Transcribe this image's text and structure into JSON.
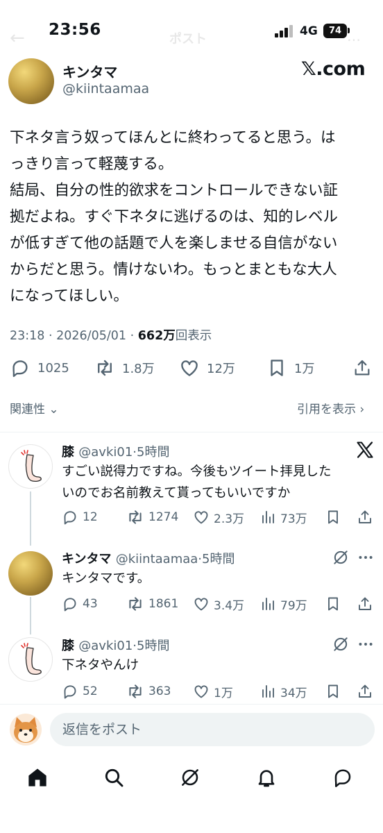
{
  "status": {
    "time": "23:56",
    "network": "4G",
    "battery": "74"
  },
  "header": {
    "back_ghost": "←",
    "title_ghost": "ポスト",
    "more_ghost": "…"
  },
  "post": {
    "name": "キンタマ",
    "handle": "@kiintaamaa",
    "watermark": "𝕏.com",
    "lines": [
      "下ネタ言う奴ってほんとに終わってると思う。は",
      "っきり言って軽蔑する。",
      "結局、自分の性的欲求をコントロールできない証",
      "拠だよね。すぐ下ネタに逃げるのは、知的レベル",
      "が低すぎて他の話題で人を楽しませる自信がない",
      "からだと思う。情けないわ。もっとまともな大人",
      "になってほしい。"
    ],
    "time": "23:18",
    "date": "2026/05/01",
    "views": "662万",
    "views_label": "回表示",
    "stats": {
      "replies": "1025",
      "reposts": "1.8万",
      "likes": "12万",
      "bookmarks": "1万"
    }
  },
  "sort": {
    "label": "関連性",
    "quotes_label": "引用を表示"
  },
  "replies": [
    {
      "name": "膝",
      "handle": "@avki01",
      "time": "5時間",
      "lines": [
        "すごい説得力ですね。今後もツイート拝見した",
        "いのでお名前教えて貰ってもいいですか"
      ],
      "stats": {
        "replies": "12",
        "reposts": "1274",
        "likes": "2.3万",
        "views": "73万"
      }
    },
    {
      "name": "キンタマ",
      "handle": "@kiintaamaa",
      "time": "5時間",
      "lines": [
        "キンタマです。"
      ],
      "stats": {
        "replies": "43",
        "reposts": "1861",
        "likes": "3.4万",
        "views": "79万"
      }
    },
    {
      "name": "膝",
      "handle": "@avki01",
      "time": "5時間",
      "lines": [
        "下ネタやんけ"
      ],
      "stats": {
        "replies": "52",
        "reposts": "363",
        "likes": "1万",
        "views": "34万"
      }
    }
  ],
  "composer": {
    "placeholder": "返信をポスト"
  },
  "colors": {
    "text": "#0f1419",
    "secondary": "#536471",
    "divider": "#eff3f4",
    "thread": "#cfd9de"
  },
  "icons": [
    "reply-icon",
    "repost-icon",
    "like-icon",
    "bookmark-icon",
    "share-icon",
    "views-icon",
    "grok-icon",
    "more-icon",
    "x-logo-icon",
    "home-icon",
    "search-icon",
    "notifications-icon",
    "messages-icon"
  ]
}
